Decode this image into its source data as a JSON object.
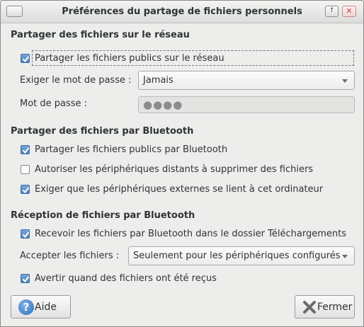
{
  "window": {
    "title": "Préférences du partage de fichiers personnels"
  },
  "network": {
    "heading": "Partager des fichiers sur le réseau",
    "share_public_label": "Partager les fichiers publics sur le réseau",
    "share_public_checked": true,
    "require_password_label": "Exiger le mot de passe :",
    "require_password_value": "Jamais",
    "password_label": "Mot de passe :",
    "password_value": "●●●●"
  },
  "bluetooth_share": {
    "heading": "Partager des fichiers par Bluetooth",
    "items": [
      {
        "label": "Partager les fichiers publics par Bluetooth",
        "checked": true
      },
      {
        "label": "Autoriser les périphériques distants à supprimer des fichiers",
        "checked": false
      },
      {
        "label": "Exiger que les périphériques externes se lient à cet ordinateur",
        "checked": true
      }
    ]
  },
  "bluetooth_receive": {
    "heading": "Réception de fichiers par Bluetooth",
    "receive_label": "Recevoir les fichiers par Bluetooth dans le dossier Téléchargements",
    "receive_checked": true,
    "accept_label": "Accepter les fichiers :",
    "accept_value": "Seulement pour les périphériques configurés",
    "notify_label": "Avertir quand des fichiers ont été reçus",
    "notify_checked": true
  },
  "buttons": {
    "help": "Aide",
    "close": "Fermer"
  },
  "icons": {
    "help": "help-icon",
    "close": "close-icon",
    "check": "checkmark-icon"
  },
  "colors": {
    "checkbox_checked": "#4f82bd",
    "close_icon": "#6b6b6b"
  }
}
